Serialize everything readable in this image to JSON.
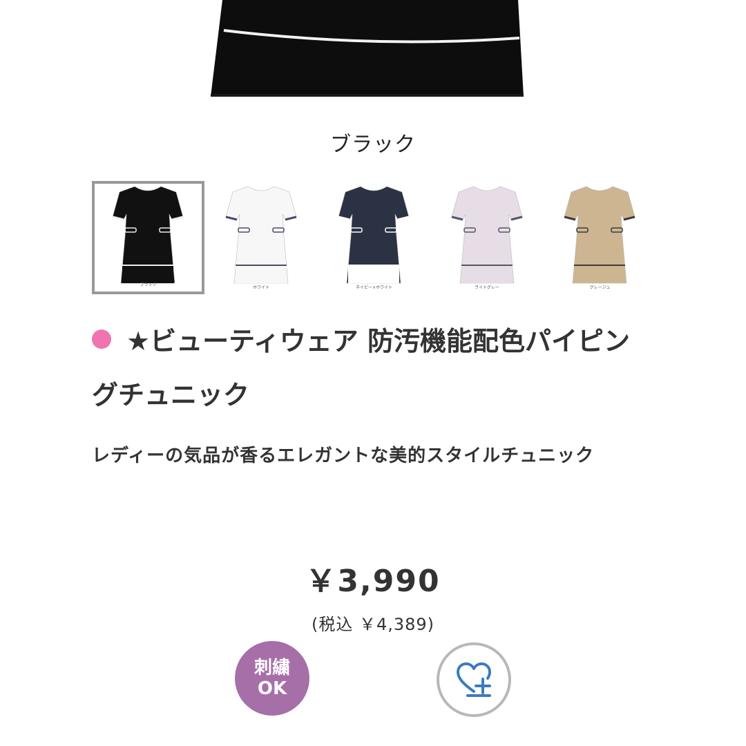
{
  "product": {
    "selected_color": "ブラック",
    "thumbnails": [
      {
        "label": "ブラック",
        "body": "#111111",
        "trim": "#eeeeee",
        "hem": "#111111",
        "selected": true
      },
      {
        "label": "ホワイト",
        "body": "#f7f7f7",
        "trim": "#4a4a6a",
        "hem": "#f7f7f7",
        "selected": false
      },
      {
        "label": "ネイビー×ホワイト",
        "body": "#2b3244",
        "trim": "#ffffff",
        "hem": "#ffffff",
        "selected": false
      },
      {
        "label": "ライトグレー",
        "body": "#e6dde6",
        "trim": "#555566",
        "hem": "#e6dde6",
        "selected": false
      },
      {
        "label": "グレージュ",
        "body": "#cdb592",
        "trim": "#3a3a3a",
        "hem": "#cdb592",
        "selected": false
      }
    ],
    "title": "★ビューティウェア 防汚機能配色パイピングチュニック",
    "description": "レディーの気品が香るエレガントな美的スタイルチュニック",
    "price": "￥3,990",
    "price_tax": "(税込 ￥4,389)",
    "badge": {
      "line1": "刺繍",
      "line2": "OK"
    },
    "colors": {
      "title_dot": "#ef74b0",
      "badge_bg": "#a66fa8",
      "fav_icon": "#3b7bbf"
    },
    "icons": {
      "favorite": "heart-plus-icon"
    }
  }
}
